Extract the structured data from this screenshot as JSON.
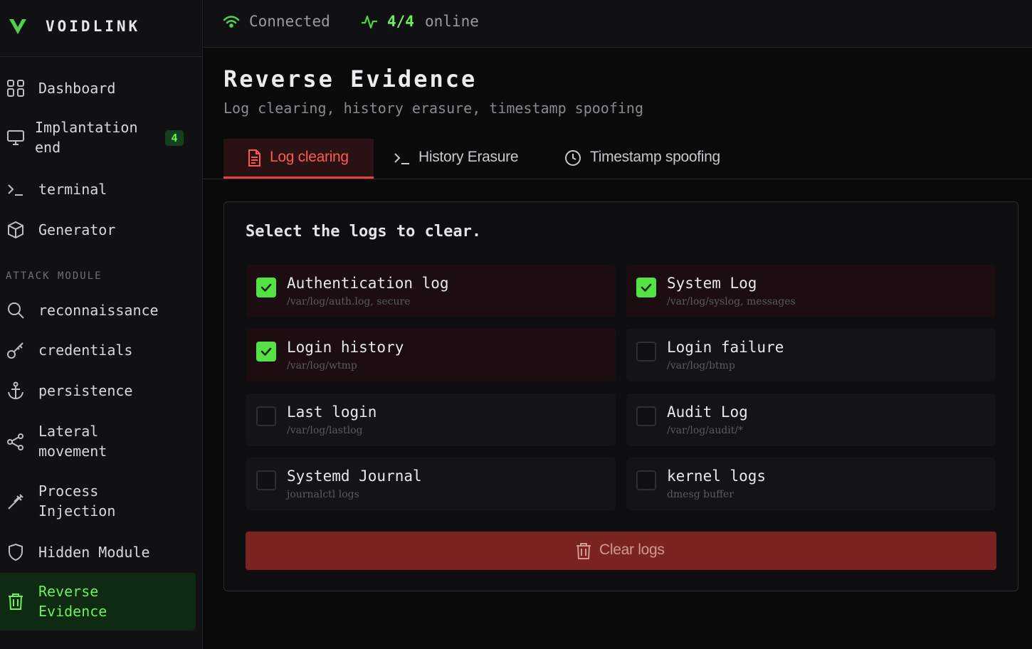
{
  "brand": {
    "name": "VOIDLINK"
  },
  "topbar": {
    "status": "Connected",
    "online_count": "4/4",
    "online_label": "online"
  },
  "sidebar": {
    "items": [
      {
        "label": "Dashboard",
        "icon": "dashboard-icon"
      },
      {
        "label": "Implantation\nend",
        "icon": "monitor-icon",
        "badge": "4"
      },
      {
        "label": "terminal",
        "icon": "terminal-icon"
      },
      {
        "label": "Generator",
        "icon": "cube-icon"
      }
    ],
    "section_title": "ATTACK MODULE",
    "attack_items": [
      {
        "label": "reconnaissance",
        "icon": "search-icon"
      },
      {
        "label": "credentials",
        "icon": "key-icon"
      },
      {
        "label": "persistence",
        "icon": "anchor-icon"
      },
      {
        "label": "Lateral\nmovement",
        "icon": "share-icon"
      },
      {
        "label": "Process\nInjection",
        "icon": "syringe-icon"
      },
      {
        "label": "Hidden Module",
        "icon": "shield-icon"
      },
      {
        "label": "Reverse\nEvidence",
        "icon": "trash-icon",
        "active": true
      }
    ]
  },
  "page": {
    "title": "Reverse Evidence",
    "subtitle": "Log clearing, history erasure, timestamp spoofing"
  },
  "tabs": [
    {
      "label": "Log clearing",
      "icon": "file-text-icon",
      "active": true
    },
    {
      "label": "History Erasure",
      "icon": "terminal-icon"
    },
    {
      "label": "Timestamp spoofing",
      "icon": "clock-icon"
    }
  ],
  "panel": {
    "title": "Select the logs to clear.",
    "logs": [
      {
        "name": "Authentication log",
        "path": "/var/log/auth.log, secure",
        "checked": true
      },
      {
        "name": "System Log",
        "path": "/var/log/syslog, messages",
        "checked": true
      },
      {
        "name": "Login history",
        "path": "/var/log/wtmp",
        "checked": true
      },
      {
        "name": "Login failure",
        "path": "/var/log/btmp",
        "checked": false
      },
      {
        "name": "Last login",
        "path": "/var/log/lastlog",
        "checked": false
      },
      {
        "name": "Audit Log",
        "path": "/var/log/audit/*",
        "checked": false
      },
      {
        "name": "Systemd Journal",
        "path": "journalctl logs",
        "checked": false
      },
      {
        "name": "kernel logs",
        "path": "dmesg buffer",
        "checked": false
      }
    ],
    "clear_button": "Clear logs"
  },
  "colors": {
    "accent_green": "#6cf05a",
    "accent_red": "#e0453d",
    "button_red": "#7a2422",
    "background": "#0a0a0b"
  }
}
